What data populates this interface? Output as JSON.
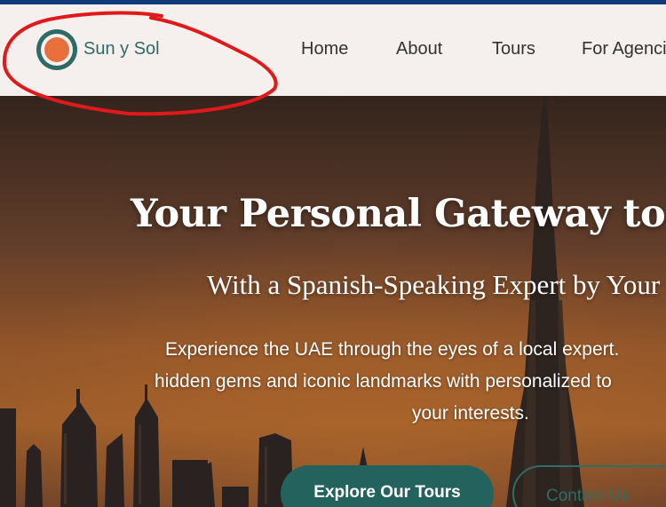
{
  "header": {
    "brand": "Sun y Sol",
    "nav": [
      "Home",
      "About",
      "Tours",
      "For Agencies"
    ]
  },
  "hero": {
    "headline": "Your Personal Gateway to the UAE",
    "subhead": "With a Spanish-Speaking Expert by Your Side",
    "description": [
      "Experience the UAE through the eyes of a local expert.",
      "hidden gems and iconic landmarks with personalized to",
      "your interests."
    ],
    "primary_button": "Explore Our Tours",
    "secondary_button": "Contact Us"
  },
  "colors": {
    "top_strip": "#123a78",
    "header_bg": "#f5f0ed",
    "brand_teal": "#2f6b66",
    "button_teal": "#24635d",
    "logo_orange": "#e8703a",
    "annotation_red": "#e01a1a"
  },
  "icons": {
    "logo": "orange-circle-logo-icon"
  }
}
